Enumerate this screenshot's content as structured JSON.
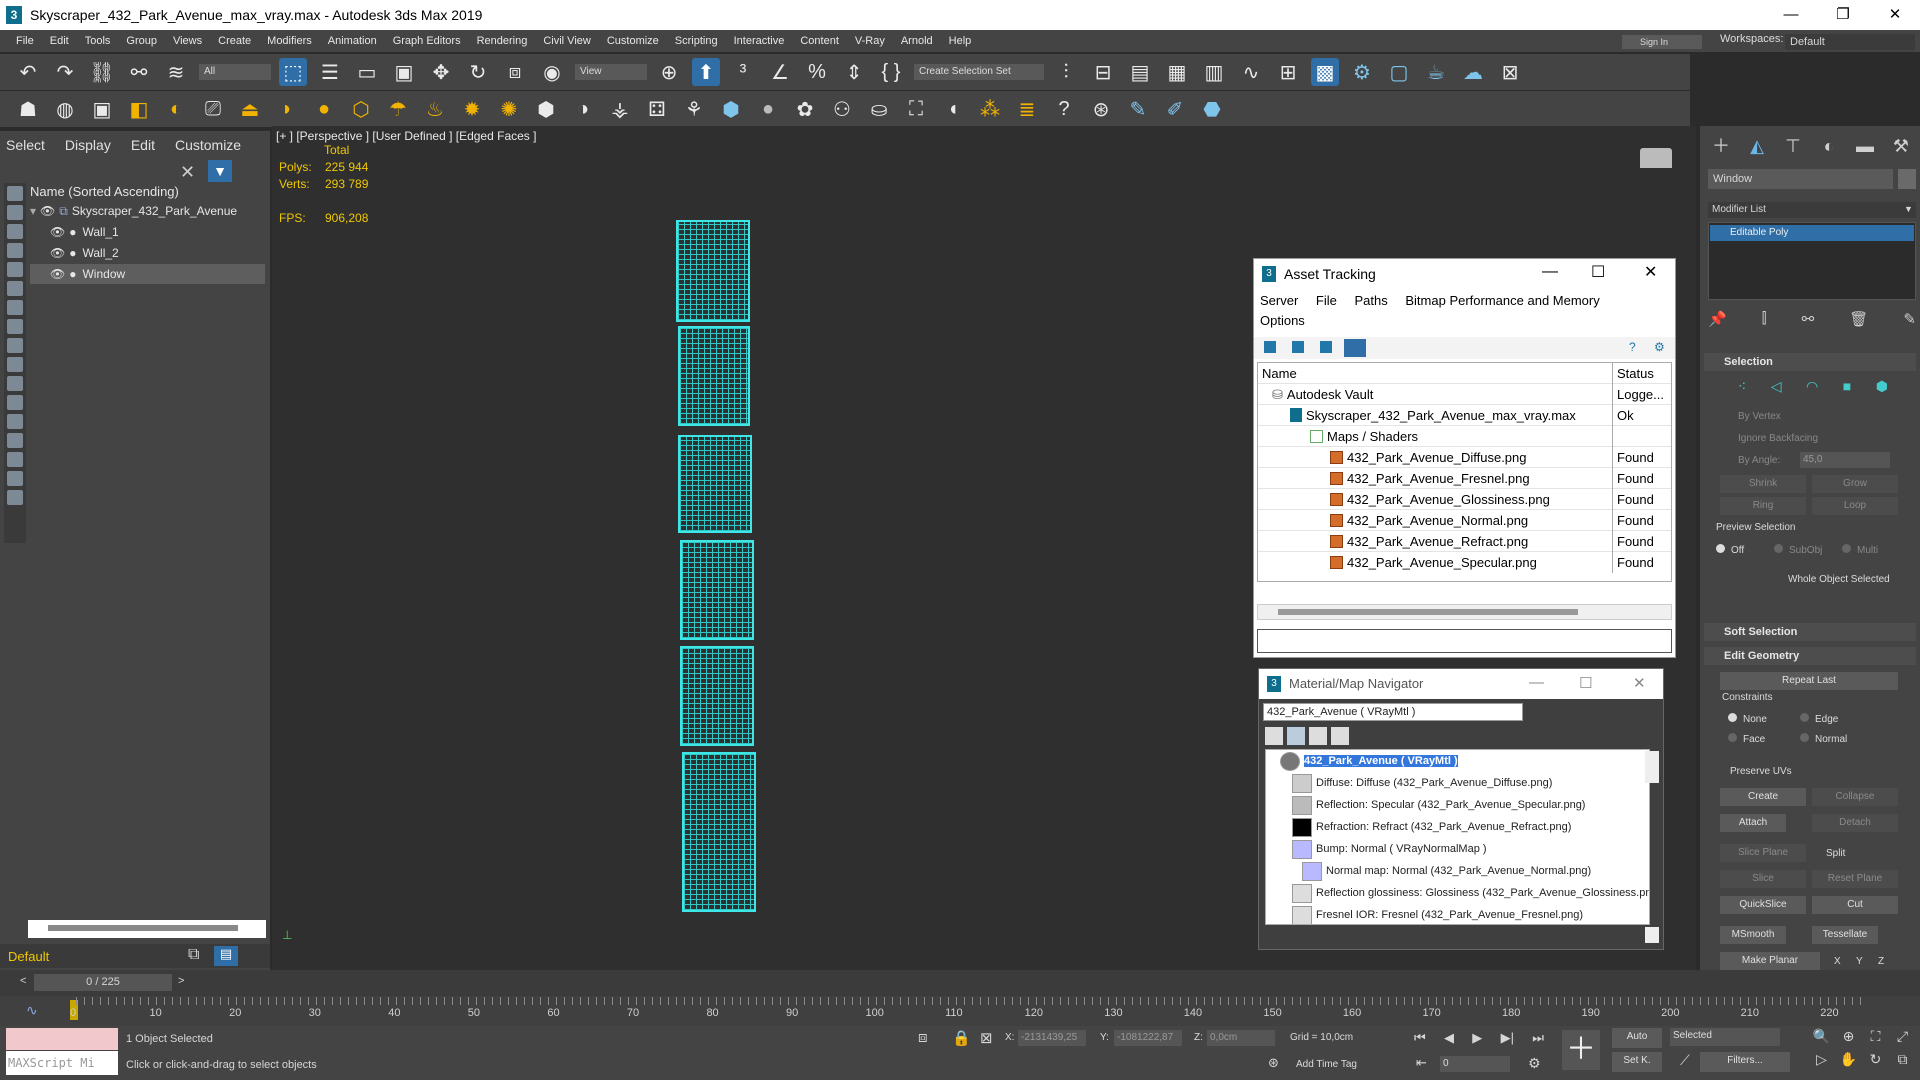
{
  "app": {
    "title": "Skyscraper_432_Park_Avenue_max_vray.max - Autodesk 3ds Max 2019",
    "logo_glyph": "3",
    "menus": [
      "File",
      "Edit",
      "Tools",
      "Group",
      "Views",
      "Create",
      "Modifiers",
      "Animation",
      "Graph Editors",
      "Rendering",
      "Civil View",
      "Customize",
      "Scripting",
      "Interactive",
      "Content",
      "V-Ray",
      "Arnold",
      "Help"
    ],
    "sign_in": "Sign In",
    "workspaces_label": "Workspaces:",
    "workspace_value": "Default"
  },
  "toolbar": {
    "filter_value": "All",
    "view_value": "View",
    "selection_set_placeholder": "Create Selection Set"
  },
  "scene_explorer": {
    "tabs": [
      "Select",
      "Display",
      "Edit",
      "Customize"
    ],
    "header": "Name (Sorted Ascending)",
    "items": [
      {
        "label": "Skyscraper_432_Park_Avenue"
      },
      {
        "label": "Wall_1"
      },
      {
        "label": "Wall_2"
      },
      {
        "label": "Window"
      }
    ],
    "layer": "Default"
  },
  "viewport": {
    "label": "[+ ] [Perspective ]  [User Defined ]  [Edged Faces ]",
    "total_label": "Total",
    "polys_label": "Polys:",
    "polys_value": "225 944",
    "verts_label": "Verts:",
    "verts_value": "293 789",
    "fps_label": "FPS:",
    "fps_value": "906,208"
  },
  "asset_tracking": {
    "title": "Asset Tracking",
    "menu": [
      "Server",
      "File",
      "Paths",
      "Bitmap Performance and Memory",
      "Options"
    ],
    "col_name": "Name",
    "col_status": "Status",
    "rows": [
      {
        "name": "Autodesk Vault",
        "status": "Logge..."
      },
      {
        "name": "Skyscraper_432_Park_Avenue_max_vray.max",
        "status": "Ok"
      },
      {
        "name": "Maps / Shaders",
        "status": ""
      },
      {
        "name": "432_Park_Avenue_Diffuse.png",
        "status": "Found"
      },
      {
        "name": "432_Park_Avenue_Fresnel.png",
        "status": "Found"
      },
      {
        "name": "432_Park_Avenue_Glossiness.png",
        "status": "Found"
      },
      {
        "name": "432_Park_Avenue_Normal.png",
        "status": "Found"
      },
      {
        "name": "432_Park_Avenue_Refract.png",
        "status": "Found"
      },
      {
        "name": "432_Park_Avenue_Specular.png",
        "status": "Found"
      }
    ]
  },
  "material_navigator": {
    "title": "Material/Map Navigator",
    "field": "432_Park_Avenue  ( VRayMtl )",
    "root": "432_Park_Avenue  ( VRayMtl )",
    "rows": [
      "Diffuse: Diffuse (432_Park_Avenue_Diffuse.png)",
      "Reflection: Specular (432_Park_Avenue_Specular.png)",
      "Refraction: Refract (432_Park_Avenue_Refract.png)",
      "Bump: Normal  ( VRayNormalMap )",
      "Normal map: Normal (432_Park_Avenue_Normal.png)",
      "Reflection glossiness: Glossiness (432_Park_Avenue_Glossiness.png)",
      "Fresnel IOR: Fresnel (432_Park_Avenue_Fresnel.png)"
    ]
  },
  "command_panel": {
    "object_name": "Window",
    "modifier_list": "Modifier List",
    "stack_item": "Editable Poly",
    "selection_title": "Selection",
    "by_vertex": "By Vertex",
    "ignore_backfacing": "Ignore Backfacing",
    "by_angle": "By Angle:",
    "angle_value": "45,0",
    "shrink": "Shrink",
    "grow": "Grow",
    "ring": "Ring",
    "loop": "Loop",
    "preview_selection": "Preview Selection",
    "off": "Off",
    "subobj": "SubObj",
    "multi": "Multi",
    "whole_object": "Whole Object Selected",
    "soft_selection": "Soft Selection",
    "edit_geometry": "Edit Geometry",
    "repeat_last": "Repeat Last",
    "constraints": "Constraints",
    "none": "None",
    "edge": "Edge",
    "face": "Face",
    "normal": "Normal",
    "preserve_uvs": "Preserve UVs",
    "create": "Create",
    "collapse": "Collapse",
    "attach": "Attach",
    "detach": "Detach",
    "slice_plane": "Slice Plane",
    "split": "Split",
    "slice": "Slice",
    "reset_plane": "Reset Plane",
    "quickslice": "QuickSlice",
    "cut": "Cut",
    "msmooth": "MSmooth",
    "tessellate": "Tessellate",
    "make_planar": "Make Planar",
    "x": "X",
    "y": "Y",
    "z": "Z"
  },
  "timeline": {
    "frame": "0 / 225",
    "ticks": [
      "0",
      "10",
      "20",
      "30",
      "40",
      "50",
      "60",
      "70",
      "80",
      "90",
      "100",
      "110",
      "120",
      "130",
      "140",
      "150",
      "160",
      "170",
      "180",
      "190",
      "200",
      "210",
      "220"
    ],
    "total_frames": 225
  },
  "status": {
    "maxscript": "MAXScript Mi",
    "objects_selected": "1 Object Selected",
    "prompt": "Click or click-and-drag to select objects",
    "x_label": "X:",
    "x_value": "-2131439,25",
    "y_label": "Y:",
    "y_value": "-1081222,87",
    "z_label": "Z:",
    "z_value": "0,0cm",
    "grid": "Grid = 10,0cm",
    "add_time_tag": "Add Time Tag",
    "auto": "Auto",
    "selected": "Selected",
    "set_key": "Set K.",
    "filters": "Filters...",
    "frame_field": "0"
  }
}
